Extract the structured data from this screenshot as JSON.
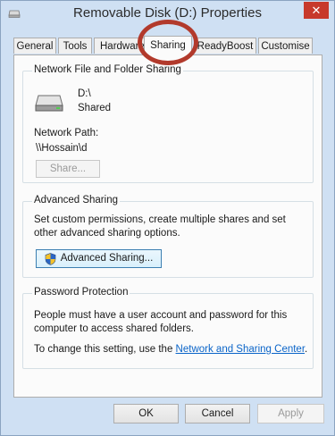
{
  "window": {
    "title": "Removable Disk (D:) Properties",
    "close_glyph": "✕"
  },
  "tabs": [
    {
      "label": "General"
    },
    {
      "label": "Tools"
    },
    {
      "label": "Hardware"
    },
    {
      "label": "Sharing",
      "active": true
    },
    {
      "label": "ReadyBoost"
    },
    {
      "label": "Customise"
    }
  ],
  "network_sharing": {
    "group_title": "Network File and Folder Sharing",
    "drive_path": "D:\\",
    "status": "Shared",
    "network_path_label": "Network Path:",
    "network_path_value": "\\\\Hossain\\d",
    "share_button": "Share..."
  },
  "advanced_sharing": {
    "group_title": "Advanced Sharing",
    "description": "Set custom permissions, create multiple shares and set other advanced sharing options.",
    "button": "Advanced Sharing..."
  },
  "password_protection": {
    "group_title": "Password Protection",
    "description": "People must have a user account and password for this computer to access shared folders.",
    "change_prefix": "To change this setting, use the ",
    "link_text": "Network and Sharing Center",
    "change_suffix": "."
  },
  "footer": {
    "ok": "OK",
    "cancel": "Cancel",
    "apply": "Apply"
  },
  "colors": {
    "close_button": "#c7392b",
    "highlight_ring": "#b23a2c",
    "link": "#0a64c8"
  }
}
